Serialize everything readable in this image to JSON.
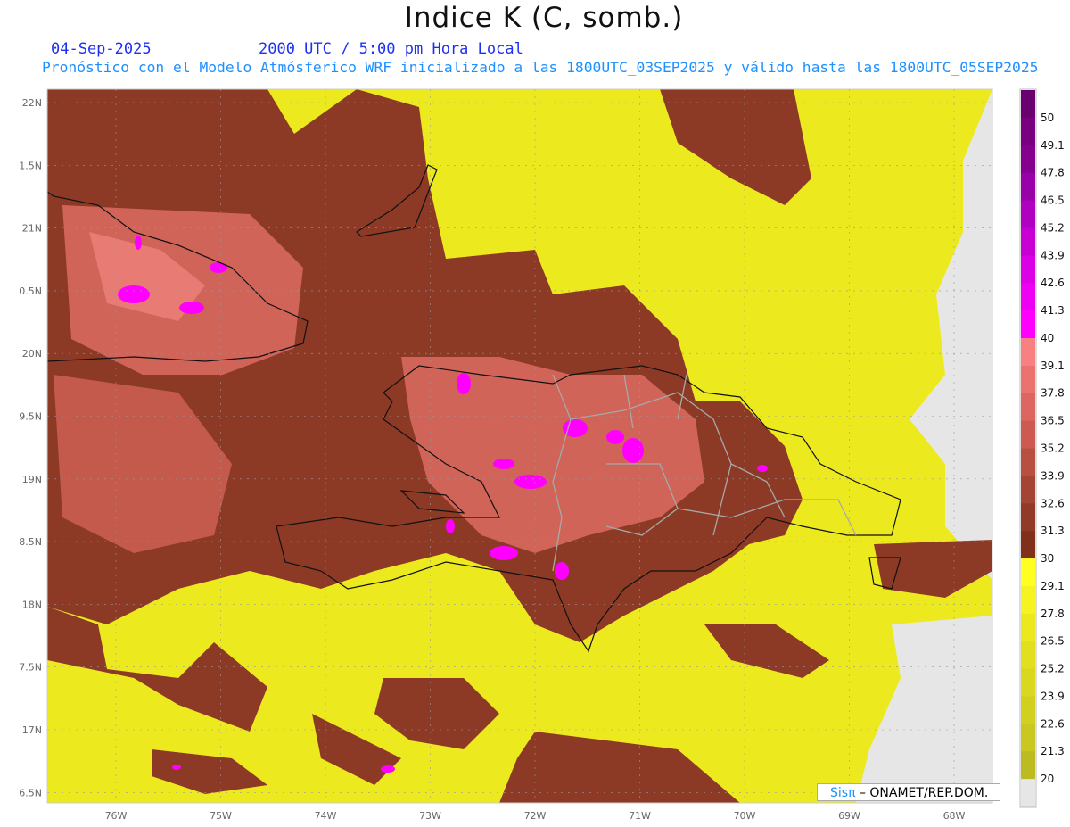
{
  "header": {
    "title": "Indice K (C, somb.)",
    "date": "04-Sep-2025",
    "time": "2000 UTC / 5:00 pm Hora Local",
    "subtitle": "Pronóstico con el Modelo Atmósferico WRF inicializado a las 1800UTC_03SEP2025 y válido hasta las  1800UTC_05SEP2025"
  },
  "axes": {
    "lat_labels": [
      "22N",
      "1.5N",
      "21N",
      "0.5N",
      "20N",
      "9.5N",
      "19N",
      "8.5N",
      "18N",
      "7.5N",
      "17N",
      "6.5N"
    ],
    "lon_labels": [
      "76W",
      "75W",
      "74W",
      "73W",
      "72W",
      "71W",
      "70W",
      "69W",
      "68W"
    ]
  },
  "colorbar": {
    "labels": [
      "50",
      "49.1",
      "47.8",
      "46.5",
      "45.2",
      "43.9",
      "42.6",
      "41.3",
      "40",
      "39.1",
      "37.8",
      "36.5",
      "35.2",
      "33.9",
      "32.6",
      "31.3",
      "30",
      "29.1",
      "27.8",
      "26.5",
      "25.2",
      "23.9",
      "22.6",
      "21.3",
      "20"
    ],
    "colors": [
      "#6a0070",
      "#780080",
      "#860090",
      "#9a00a8",
      "#b000c0",
      "#c800d4",
      "#dc00e4",
      "#ee00f2",
      "#ff00ff",
      "#f88080",
      "#ec7270",
      "#de6660",
      "#cc5a50",
      "#b85040",
      "#a44434",
      "#923a28",
      "#80301a",
      "#ffff20",
      "#f6f420",
      "#ece81e",
      "#e2e01e",
      "#dad81e",
      "#d2d01e",
      "#c8c820",
      "#bcbc22",
      "#e6e6e6"
    ]
  },
  "credit": {
    "brand": "Sisπ",
    "text": " –  ONAMET/REP.DOM."
  }
}
